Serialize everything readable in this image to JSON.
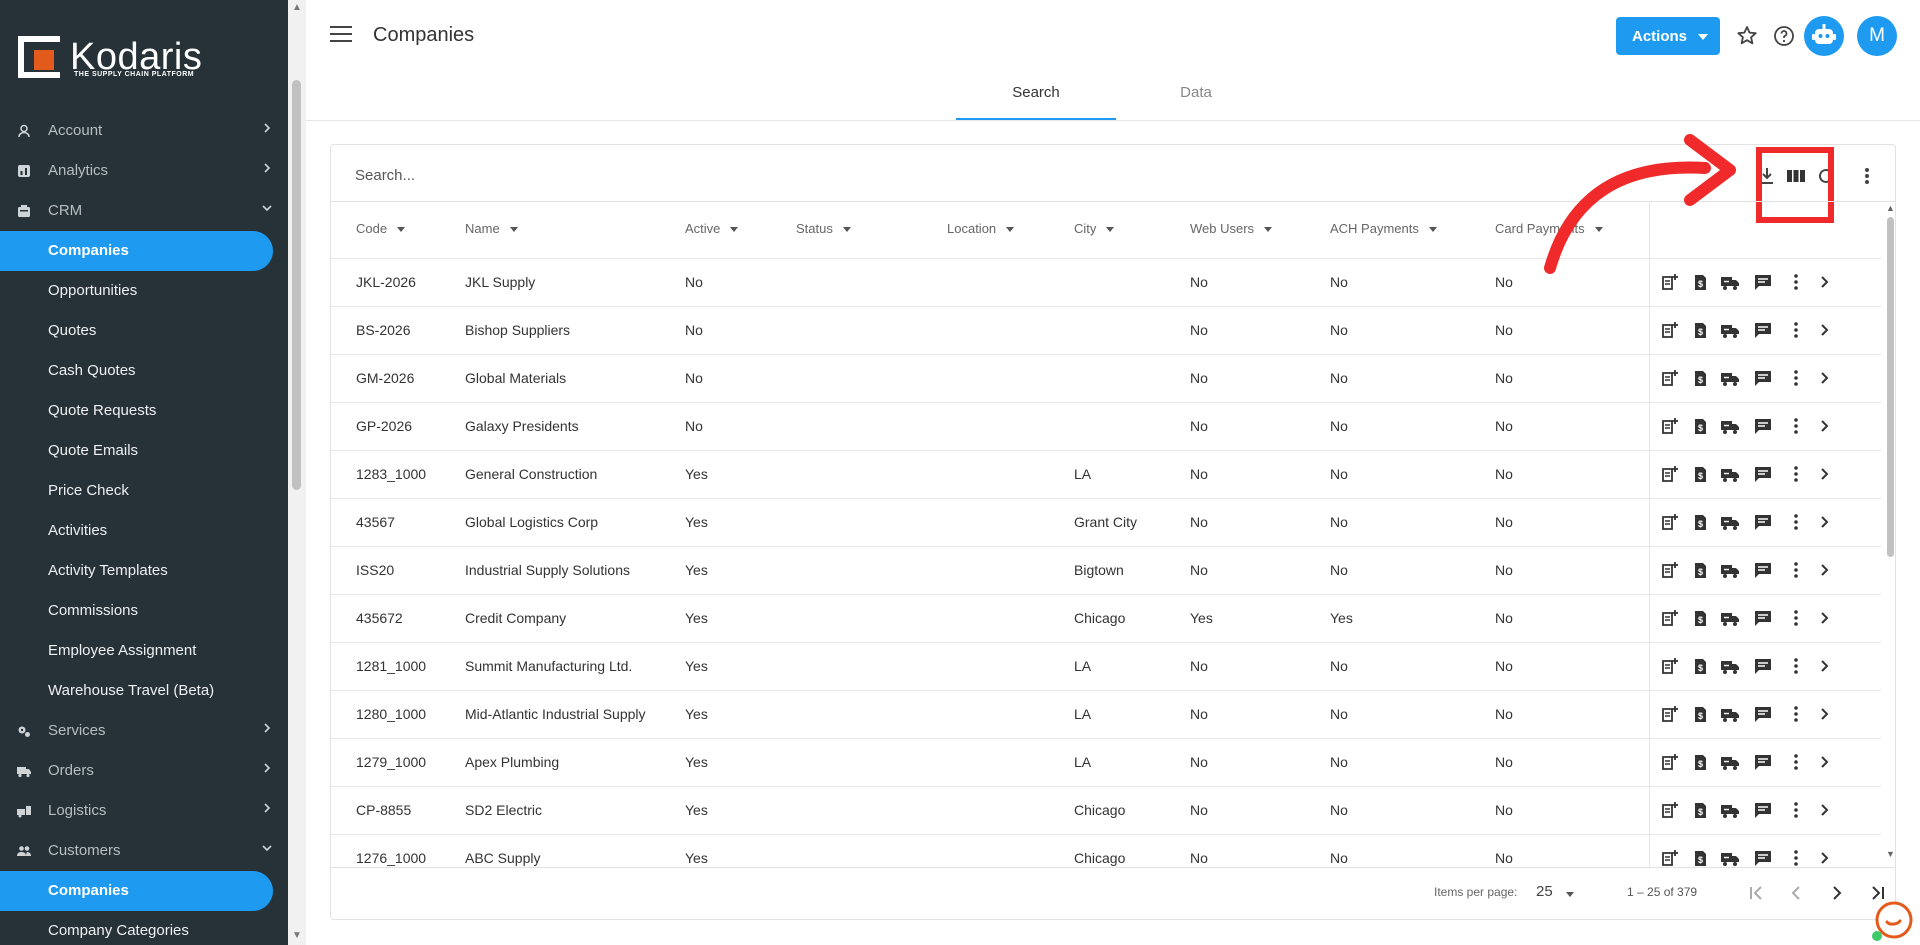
{
  "app": {
    "brand": "Kodaris",
    "tagline": "THE SUPPLY CHAIN PLATFORM",
    "accent_color": "#1e9bf0",
    "sidebar_color": "#263238",
    "highlight_color": "#f02a2a"
  },
  "sidebar": {
    "items": [
      {
        "label": "Account",
        "icon": "user-icon",
        "expand": "chevron-right-icon"
      },
      {
        "label": "Analytics",
        "icon": "chart-icon",
        "expand": "chevron-right-icon"
      },
      {
        "label": "CRM",
        "icon": "crm-icon",
        "expand": "chevron-down-icon"
      }
    ],
    "crm_sub": [
      "Companies",
      "Opportunities",
      "Quotes",
      "Cash Quotes",
      "Quote Requests",
      "Quote Emails",
      "Price Check",
      "Activities",
      "Activity Templates",
      "Commissions",
      "Employee Assignment",
      "Warehouse Travel (Beta)"
    ],
    "items2": [
      {
        "label": "Services",
        "icon": "gears-icon",
        "expand": "chevron-right-icon"
      },
      {
        "label": "Orders",
        "icon": "truck-icon",
        "expand": "chevron-right-icon"
      },
      {
        "label": "Logistics",
        "icon": "logistics-icon",
        "expand": "chevron-right-icon"
      },
      {
        "label": "Customers",
        "icon": "people-icon",
        "expand": "chevron-down-icon"
      }
    ],
    "customers_sub": [
      "Companies",
      "Company Categories"
    ]
  },
  "header": {
    "title": "Companies",
    "actions_label": "Actions",
    "avatar_initial": "M"
  },
  "tabs": [
    {
      "label": "Search",
      "active": true
    },
    {
      "label": "Data",
      "active": false
    }
  ],
  "search": {
    "placeholder": "Search..."
  },
  "table": {
    "columns": [
      "Code",
      "Name",
      "Active",
      "Status",
      "Location",
      "City",
      "Web Users",
      "ACH Payments",
      "Card Payments"
    ],
    "rows": [
      [
        "JKL-2026",
        "JKL Supply",
        "No",
        "",
        "",
        "",
        "No",
        "No",
        "No"
      ],
      [
        "BS-2026",
        "Bishop Suppliers",
        "No",
        "",
        "",
        "",
        "No",
        "No",
        "No"
      ],
      [
        "GM-2026",
        "Global Materials",
        "No",
        "",
        "",
        "",
        "No",
        "No",
        "No"
      ],
      [
        "GP-2026",
        "Galaxy Presidents",
        "No",
        "",
        "",
        "",
        "No",
        "No",
        "No"
      ],
      [
        "1283_1000",
        "General Construction",
        "Yes",
        "",
        "",
        "LA",
        "No",
        "No",
        "No"
      ],
      [
        "43567",
        "Global Logistics Corp",
        "Yes",
        "",
        "",
        "Grant City",
        "No",
        "No",
        "No"
      ],
      [
        "ISS20",
        "Industrial Supply Solutions",
        "Yes",
        "",
        "",
        "Bigtown",
        "No",
        "No",
        "No"
      ],
      [
        "435672",
        "Credit Company",
        "Yes",
        "",
        "",
        "Chicago",
        "Yes",
        "Yes",
        "No"
      ],
      [
        "1281_1000",
        "Summit Manufacturing Ltd.",
        "Yes",
        "",
        "",
        "LA",
        "No",
        "No",
        "No"
      ],
      [
        "1280_1000",
        "Mid-Atlantic Industrial Supply",
        "Yes",
        "",
        "",
        "LA",
        "No",
        "No",
        "No"
      ],
      [
        "1279_1000",
        "Apex Plumbing",
        "Yes",
        "",
        "",
        "LA",
        "No",
        "No",
        "No"
      ],
      [
        "CP-8855",
        "SD2 Electric",
        "Yes",
        "",
        "",
        "Chicago",
        "No",
        "No",
        "No"
      ],
      [
        "1276_1000",
        "ABC Supply",
        "Yes",
        "",
        "",
        "Chicago",
        "No",
        "No",
        "No"
      ]
    ],
    "row_action_icons": [
      "add-note-icon",
      "quote-icon",
      "delivery-truck-icon",
      "comment-icon",
      "more-vert-icon",
      "chevron-right-icon"
    ]
  },
  "pagination": {
    "items_per_page_label": "Items per page:",
    "items_per_page": "25",
    "range": "1 – 25 of 379"
  }
}
